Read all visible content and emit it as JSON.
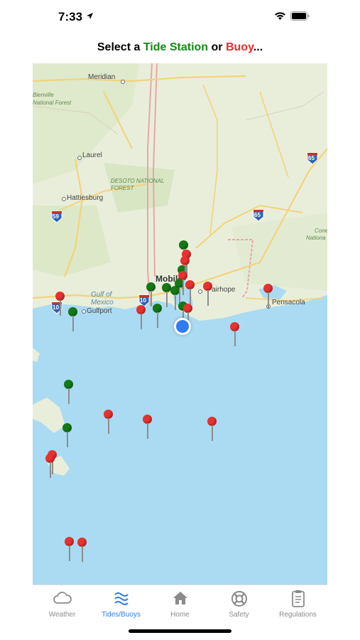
{
  "status_bar": {
    "time": "7:33"
  },
  "header": {
    "prompt_before": "Select a ",
    "tide_station": "Tide Station",
    "prompt_or": " or ",
    "buoy": "Buoy",
    "prompt_after": "..."
  },
  "map": {
    "labels": {
      "meridian": "Meridian",
      "bienville": "Bienville",
      "national_forest": "National Forest",
      "laurel": "Laurel",
      "desoto": "DESOTO NATIONAL",
      "forest": "FOREST",
      "hattiesburg": "Hattiesburg",
      "mobile": "Mobile",
      "fairhope": "Fairhope",
      "pensacola": "Pensacola",
      "gulfport": "Gulfport",
      "gulf_of_mexico_1": "Gulf of",
      "gulf_of_mexico_2": "Mexico",
      "conecuh_1": "Cone",
      "conecuh_2": "Nationa",
      "i10_left": "10",
      "i10_mid": "10",
      "i59": "59",
      "i65_top": "65",
      "i65_mid": "65"
    },
    "colors": {
      "tide_station": "#157a16",
      "buoy": "#e8322f",
      "water": "#aadbf2",
      "land": "#e9eedb"
    }
  },
  "tabs": [
    {
      "label": "Weather",
      "icon": "cloud-icon",
      "active": false
    },
    {
      "label": "Tides/Buoys",
      "icon": "waves-icon",
      "active": true
    },
    {
      "label": "Home",
      "icon": "house-icon",
      "active": false
    },
    {
      "label": "Safety",
      "icon": "lifebuoy-icon",
      "active": false
    },
    {
      "label": "Regulations",
      "icon": "clipboard-icon",
      "active": false
    }
  ]
}
